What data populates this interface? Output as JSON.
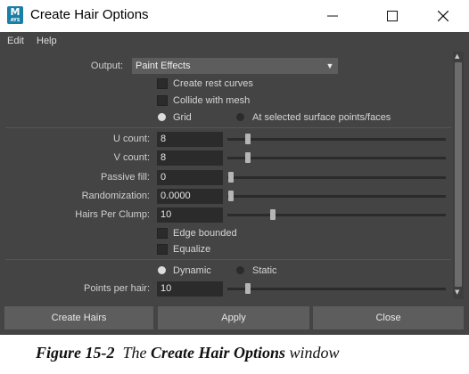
{
  "window": {
    "title": "Create Hair Options",
    "app_icon_letter": "M",
    "app_icon_sub": "AYS"
  },
  "menubar": {
    "items": [
      "Edit",
      "Help"
    ]
  },
  "output": {
    "label": "Output:",
    "value": "Paint Effects"
  },
  "checkboxes_top": [
    {
      "label": "Create rest curves",
      "checked": false
    },
    {
      "label": "Collide with mesh",
      "checked": false
    }
  ],
  "placement": {
    "options": [
      "Grid",
      "At selected surface points/faces"
    ],
    "selected": "Grid"
  },
  "params": [
    {
      "label": "U count:",
      "value": "8",
      "slider": 0.1
    },
    {
      "label": "V count:",
      "value": "8",
      "slider": 0.1
    },
    {
      "label": "Passive fill:",
      "value": "0",
      "slider": 0.0
    },
    {
      "label": "Randomization:",
      "value": "0.0000",
      "slider": 0.0
    },
    {
      "label": "Hairs Per Clump:",
      "value": "10",
      "slider": 0.2
    }
  ],
  "checkboxes_bottom": [
    {
      "label": "Edge bounded",
      "checked": false
    },
    {
      "label": "Equalize",
      "checked": false
    }
  ],
  "dynamics": {
    "options": [
      "Dynamic",
      "Static"
    ],
    "selected": "Dynamic"
  },
  "points_per_hair": {
    "label": "Points per hair:",
    "value": "10",
    "slider": 0.1
  },
  "buttons": {
    "create": "Create Hairs",
    "apply": "Apply",
    "close": "Close"
  },
  "caption": {
    "figure": "Figure 15-2",
    "the": "The",
    "name": "Create Hair Options",
    "suffix": "window"
  },
  "colors": {
    "bg": "#444444",
    "field": "#2b2b2b",
    "button": "#5d5d5d"
  }
}
